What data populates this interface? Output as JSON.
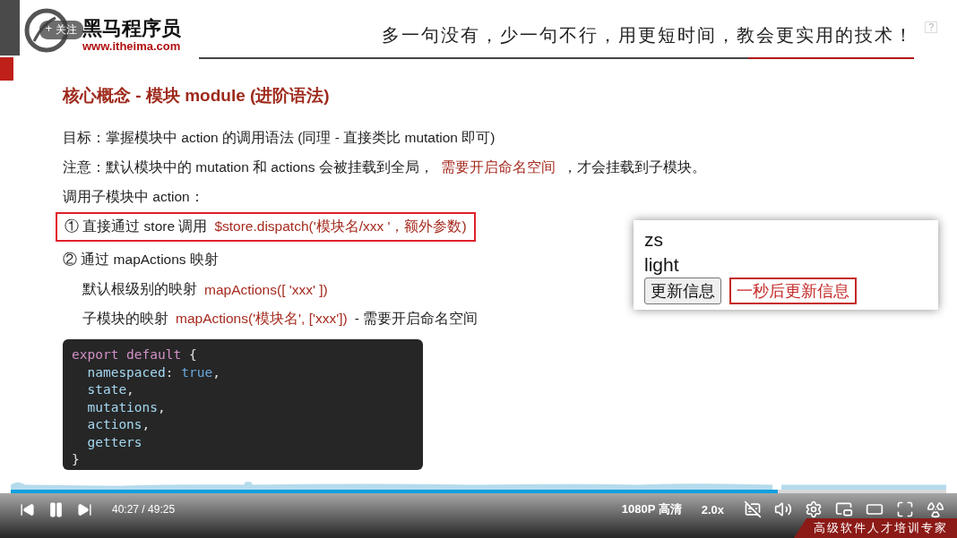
{
  "slide": {
    "logo": {
      "name": "黑马程序员",
      "url": "www.itheima.com"
    },
    "follow_button": {
      "icon": "+",
      "label": "关注"
    },
    "slogan": "多一句没有，少一句不行，用更短时间，教会更实用的技术！",
    "help_badge": "?",
    "title": "核心概念 - 模块 module (进阶语法)",
    "lines": [
      {
        "indent": false,
        "boxed": false,
        "segments": [
          {
            "text": "目标：掌握模块中 action 的调用语法 (同理 - 直接类比 mutation 即可)",
            "accent": false
          }
        ]
      },
      {
        "indent": false,
        "boxed": false,
        "segments": [
          {
            "text": "注意：默认模块中的 mutation 和 actions 会被挂载到全局，",
            "accent": false
          },
          {
            "text": "需要开启命名空间",
            "accent": true
          },
          {
            "text": "，才会挂载到子模块。",
            "accent": false
          }
        ]
      },
      {
        "indent": false,
        "boxed": false,
        "segments": [
          {
            "text": "调用子模块中 action：",
            "accent": false
          }
        ]
      },
      {
        "indent": false,
        "boxed": true,
        "segments": [
          {
            "text": "① 直接通过 store 调用",
            "accent": false
          },
          {
            "text": "$store.dispatch('模块名/xxx '，额外参数)",
            "accent": true
          }
        ]
      },
      {
        "indent": false,
        "boxed": false,
        "segments": [
          {
            "text": "② 通过 mapActions 映射",
            "accent": false
          }
        ]
      },
      {
        "indent": true,
        "boxed": false,
        "segments": [
          {
            "text": "默认根级别的映射",
            "accent": false
          },
          {
            "text": "mapActions([ 'xxx' ])",
            "accent": true
          }
        ]
      },
      {
        "indent": true,
        "boxed": false,
        "segments": [
          {
            "text": "子模块的映射",
            "accent": false
          },
          {
            "text": "mapActions('模块名', ['xxx'])",
            "accent": true
          },
          {
            "text": "-  需要开启命名空间",
            "accent": false
          }
        ]
      }
    ],
    "code": [
      [
        {
          "text": "export default",
          "kind": "keyword"
        },
        {
          "text": " {",
          "kind": "punct"
        }
      ],
      [
        {
          "text": "  namespaced",
          "kind": "name"
        },
        {
          "text": ": ",
          "kind": "punct"
        },
        {
          "text": "true",
          "kind": "value"
        },
        {
          "text": ",",
          "kind": "punct"
        }
      ],
      [
        {
          "text": "  state",
          "kind": "name"
        },
        {
          "text": ",",
          "kind": "punct"
        }
      ],
      [
        {
          "text": "  mutations",
          "kind": "name"
        },
        {
          "text": ",",
          "kind": "punct"
        }
      ],
      [
        {
          "text": "  actions",
          "kind": "name"
        },
        {
          "text": ",",
          "kind": "punct"
        }
      ],
      [
        {
          "text": "  getters",
          "kind": "name"
        }
      ],
      [
        {
          "text": "}",
          "kind": "punct"
        }
      ]
    ],
    "demo": {
      "texts": [
        "zs",
        "light"
      ],
      "buttons": [
        {
          "label": "更新信息",
          "highlighted": false
        },
        {
          "label": "一秒后更新信息",
          "highlighted": true
        }
      ]
    },
    "footer": "高级软件人才培训专家"
  },
  "player": {
    "level": 0.82,
    "playing": true,
    "time": "40:27 / 49:25",
    "quality": "1080P 高清",
    "speed": "2.0x"
  }
}
